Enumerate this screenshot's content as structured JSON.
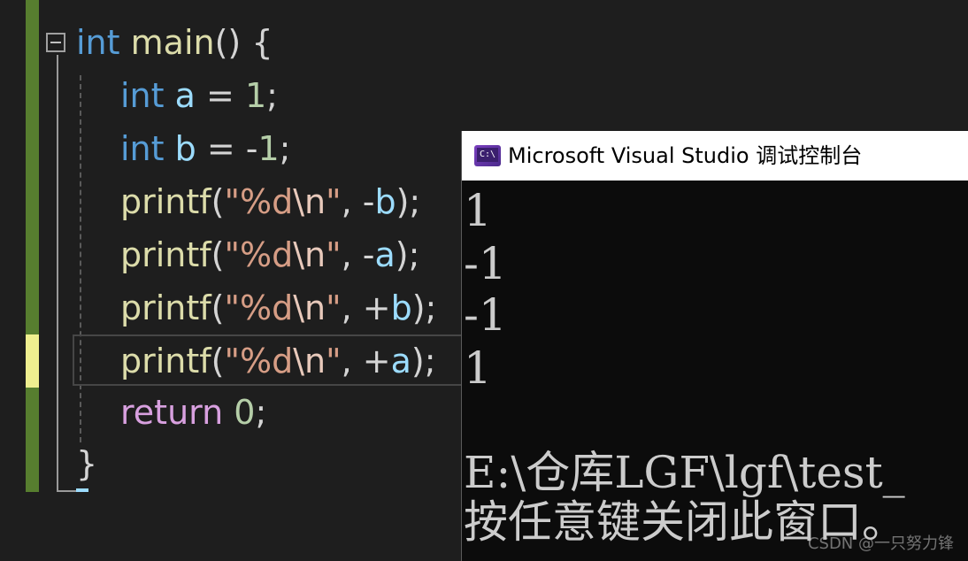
{
  "editor": {
    "line1": {
      "kw": "int",
      "fn": "main",
      "rest": "() {"
    },
    "line2": {
      "kw": "int",
      "var": "a",
      "op": " = ",
      "num": "1",
      "end": ";"
    },
    "line3": {
      "kw": "int",
      "var": "b",
      "op": " = -",
      "num": "1",
      "end": ";"
    },
    "line4": {
      "fn": "printf",
      "open": "(",
      "str1": "\"%d",
      "esc": "\\n",
      "str2": "\"",
      "sep": ", -",
      "var": "b",
      "end": ");"
    },
    "line5": {
      "fn": "printf",
      "open": "(",
      "str1": "\"%d",
      "esc": "\\n",
      "str2": "\"",
      "sep": ", -",
      "var": "a",
      "end": ");"
    },
    "line6": {
      "fn": "printf",
      "open": "(",
      "str1": "\"%d",
      "esc": "\\n",
      "str2": "\"",
      "sep": ", +",
      "var": "b",
      "end": ");"
    },
    "line7": {
      "fn": "printf",
      "open": "(",
      "str1": "\"%d",
      "esc": "\\n",
      "str2": "\"",
      "sep": ", +",
      "var": "a",
      "end": ");"
    },
    "line8": {
      "kw": "return",
      "num": "0",
      "end": ";"
    },
    "line9": {
      "brace": "}"
    }
  },
  "console": {
    "title": "Microsoft Visual Studio 调试控制台",
    "icon_text": "C:\\",
    "output": [
      "1",
      "-1",
      "-1",
      "1"
    ],
    "path_line": "E:\\仓库LGF\\lgf\\test_",
    "prompt_line": "按任意键关闭此窗口。"
  },
  "watermark": "CSDN @一只努力锋",
  "icons": {
    "fold": "collapse-minus-icon",
    "console": "console-app-icon"
  },
  "colors": {
    "keyword": "#569cd6",
    "function": "#dcdcaa",
    "variable": "#9cdcfe",
    "number": "#b5cea8",
    "string": "#d69d85",
    "control": "#d8a0df",
    "change_saved": "#577e2f",
    "change_unsaved": "#efef8f"
  }
}
